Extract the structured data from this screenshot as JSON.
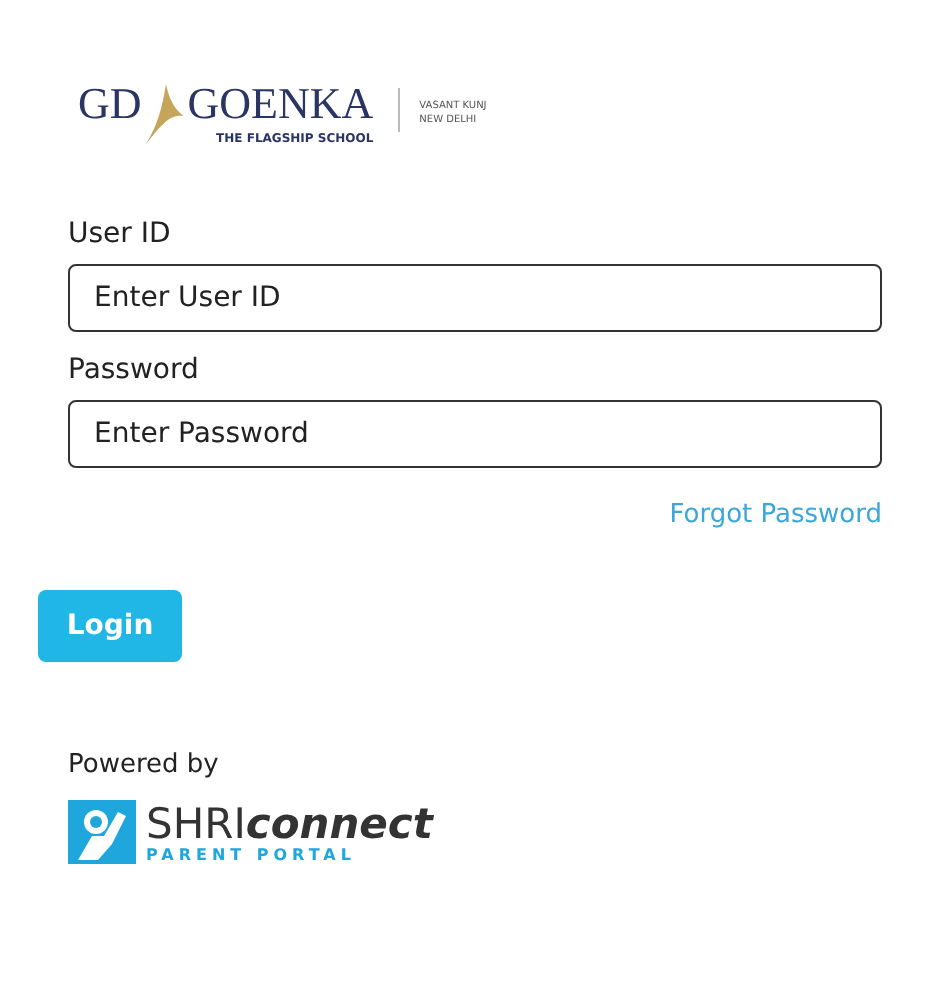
{
  "school_logo": {
    "name_left": "GD",
    "name_right": "GOENKA",
    "tagline": "THE FLAGSHIP SCHOOL",
    "campus_lines": [
      "VASANT KUNJ",
      "NEW DELHI"
    ]
  },
  "fields": [
    {
      "label": "User ID",
      "placeholder": "Enter User ID"
    },
    {
      "label": "Password",
      "placeholder": "Enter Password"
    }
  ],
  "forgot_link": "Forgot Password",
  "login_button": "Login",
  "powered_by": "Powered by",
  "vendor_logo": {
    "brand": "SHRI",
    "brand_accent": "connect",
    "subtitle": "PARENT PORTAL"
  }
}
